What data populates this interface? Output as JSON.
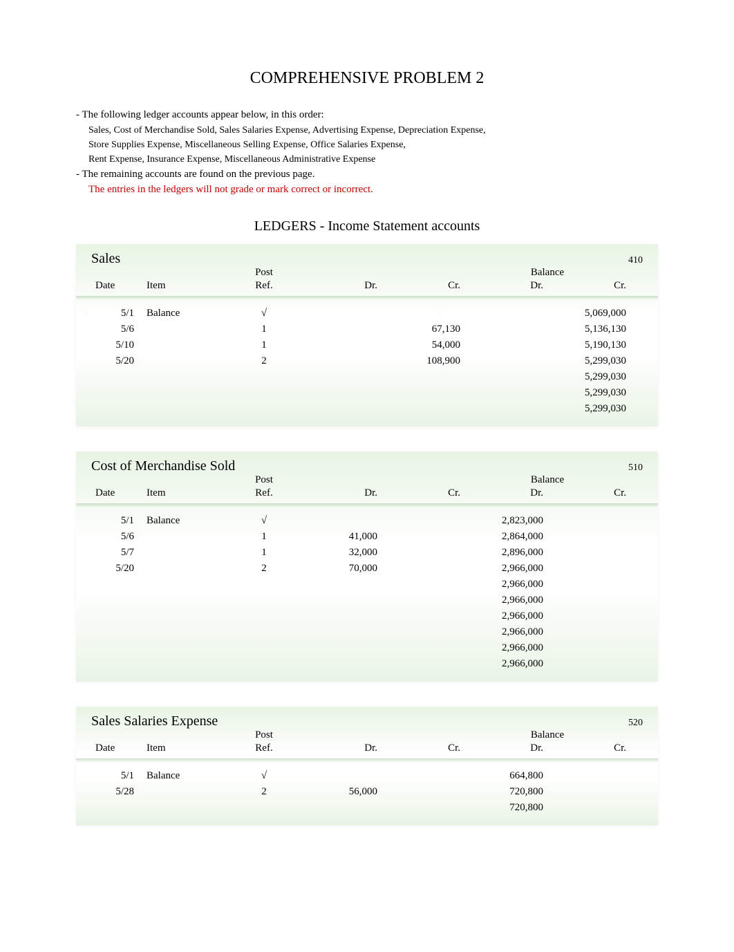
{
  "title": "COMPREHENSIVE PROBLEM 2",
  "intro": {
    "bullet1": "-  The following ledger accounts appear below, in this order:",
    "sub1": "Sales,    Cost of Merchandise Sold, Sales Salaries Expense, Advertising Expense, Depreciation Expense,",
    "sub2": " Store Supplies Expense, Miscellaneous Selling Expense, Office Salaries Expense,",
    "sub3": "Rent Expense, Insurance Expense, Miscellaneous Administrative Expense",
    "bullet2": "- The remaining accounts are found on the previous page.",
    "redline": "The entries in the ledgers will not grade or mark correct or incorrect."
  },
  "sectionHead": "LEDGERS - Income Statement accounts",
  "cols": {
    "date": "Date",
    "item": "Item",
    "post": "Post",
    "ref": "Ref.",
    "dr": "Dr.",
    "cr": "Cr.",
    "balance": "Balance"
  },
  "ledgers": [
    {
      "name": "Sales",
      "number": "410",
      "rows": [
        {
          "date": "5/1",
          "item": "Balance",
          "ref": "√",
          "dr": "",
          "cr": "",
          "bdr": "",
          "bcr": "5,069,000"
        },
        {
          "date": "5/6",
          "item": "",
          "ref": "1",
          "dr": "",
          "cr": "67,130",
          "bdr": "",
          "bcr": "5,136,130"
        },
        {
          "date": "5/10",
          "item": "",
          "ref": "1",
          "dr": "",
          "cr": "54,000",
          "bdr": "",
          "bcr": "5,190,130"
        },
        {
          "date": "5/20",
          "item": "",
          "ref": "2",
          "dr": "",
          "cr": "108,900",
          "bdr": "",
          "bcr": "5,299,030"
        },
        {
          "date": "",
          "item": "",
          "ref": "",
          "dr": "",
          "cr": "",
          "bdr": "",
          "bcr": "5,299,030"
        },
        {
          "date": "",
          "item": "",
          "ref": "",
          "dr": "",
          "cr": "",
          "bdr": "",
          "bcr": "5,299,030"
        },
        {
          "date": "",
          "item": "",
          "ref": "",
          "dr": "",
          "cr": "",
          "bdr": "",
          "bcr": "5,299,030"
        }
      ]
    },
    {
      "name": "Cost of Merchandise Sold",
      "number": "510",
      "rows": [
        {
          "date": "5/1",
          "item": "Balance",
          "ref": "√",
          "dr": "",
          "cr": "",
          "bdr": "2,823,000",
          "bcr": ""
        },
        {
          "date": "5/6",
          "item": "",
          "ref": "1",
          "dr": "41,000",
          "cr": "",
          "bdr": "2,864,000",
          "bcr": ""
        },
        {
          "date": "5/7",
          "item": "",
          "ref": "1",
          "dr": "32,000",
          "cr": "",
          "bdr": "2,896,000",
          "bcr": ""
        },
        {
          "date": "5/20",
          "item": "",
          "ref": "2",
          "dr": "70,000",
          "cr": "",
          "bdr": "2,966,000",
          "bcr": ""
        },
        {
          "date": "",
          "item": "",
          "ref": "",
          "dr": "",
          "cr": "",
          "bdr": "2,966,000",
          "bcr": ""
        },
        {
          "date": "",
          "item": "",
          "ref": "",
          "dr": "",
          "cr": "",
          "bdr": "2,966,000",
          "bcr": ""
        },
        {
          "date": "",
          "item": "",
          "ref": "",
          "dr": "",
          "cr": "",
          "bdr": "2,966,000",
          "bcr": ""
        },
        {
          "date": "",
          "item": "",
          "ref": "",
          "dr": "",
          "cr": "",
          "bdr": "2,966,000",
          "bcr": ""
        },
        {
          "date": "",
          "item": "",
          "ref": "",
          "dr": "",
          "cr": "",
          "bdr": "2,966,000",
          "bcr": ""
        },
        {
          "date": "",
          "item": "",
          "ref": "",
          "dr": "",
          "cr": "",
          "bdr": "2,966,000",
          "bcr": ""
        }
      ]
    },
    {
      "name": "Sales Salaries Expense",
      "number": "520",
      "rows": [
        {
          "date": "5/1",
          "item": "Balance",
          "ref": "√",
          "dr": "",
          "cr": "",
          "bdr": "664,800",
          "bcr": ""
        },
        {
          "date": "5/28",
          "item": "",
          "ref": "2",
          "dr": "56,000",
          "cr": "",
          "bdr": "720,800",
          "bcr": ""
        },
        {
          "date": "",
          "item": "",
          "ref": "",
          "dr": "",
          "cr": "",
          "bdr": "720,800",
          "bcr": ""
        }
      ]
    }
  ]
}
